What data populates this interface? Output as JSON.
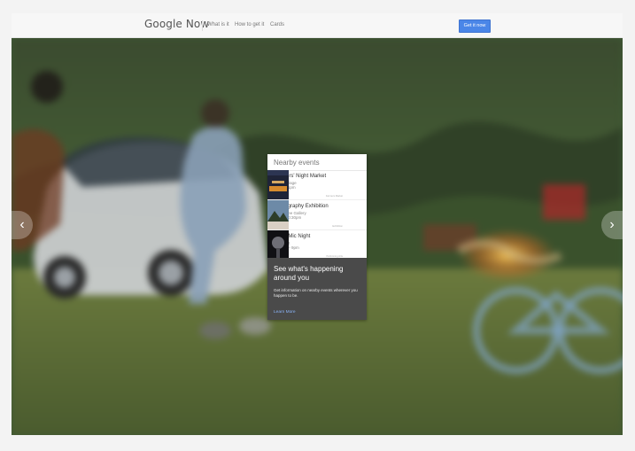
{
  "top_bar": {
    "brand": "Google Now",
    "nav": [
      {
        "label": "What is it"
      },
      {
        "label": "How to get it"
      },
      {
        "label": "Cards"
      }
    ],
    "cta_label": "Get it now"
  },
  "card": {
    "title": "Nearby events",
    "events": [
      {
        "name": "Farmers' Night Market",
        "place": "Curry Village",
        "time": "6pm – 11pm",
        "tag": "Farmers Market"
      },
      {
        "name": "Photography Exhibition",
        "place": "Ahwahnee Gallery",
        "time": "8pm – 10:30pm",
        "tag": "Exhibition"
      },
      {
        "name": "Open Mic Night",
        "place": "Oakhurst",
        "time": "6:30pm – 9pm",
        "tag": "Performing Arts"
      }
    ],
    "footer": {
      "title": "See what's happening around you",
      "text": "Get information on nearby events wherever you happen to be.",
      "link": "Learn More"
    }
  },
  "icons": {
    "left_arrow": "chevron-left-icon",
    "right_arrow": "chevron-right-icon"
  },
  "colors": {
    "cta": "#4a86e8",
    "footer": "#4a4a4a"
  }
}
